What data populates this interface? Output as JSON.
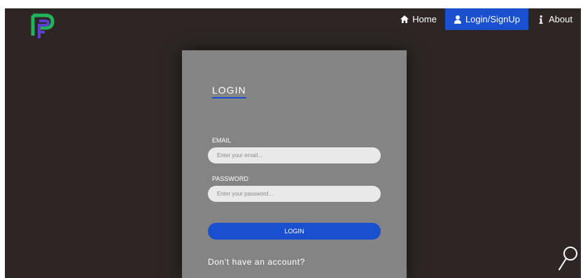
{
  "nav": {
    "items": [
      {
        "label": "Home",
        "icon": "home-icon",
        "active": false
      },
      {
        "label": "Login/SignUp",
        "icon": "user-icon",
        "active": true
      },
      {
        "label": "About",
        "icon": "info-icon",
        "active": false
      }
    ]
  },
  "login": {
    "title": "LOGIN",
    "email_label": "EMAIL",
    "email_placeholder": "Enter your email...",
    "password_label": "PASSWORD",
    "password_placeholder": "Enter your password...",
    "submit_label": "LOGIN",
    "signup_prompt": "Don't have an account?"
  },
  "colors": {
    "background": "#2d2624",
    "card": "#848484",
    "accent": "#1a4fcf",
    "logo_green": "#22b35a",
    "logo_purple": "#5a3fd0"
  }
}
